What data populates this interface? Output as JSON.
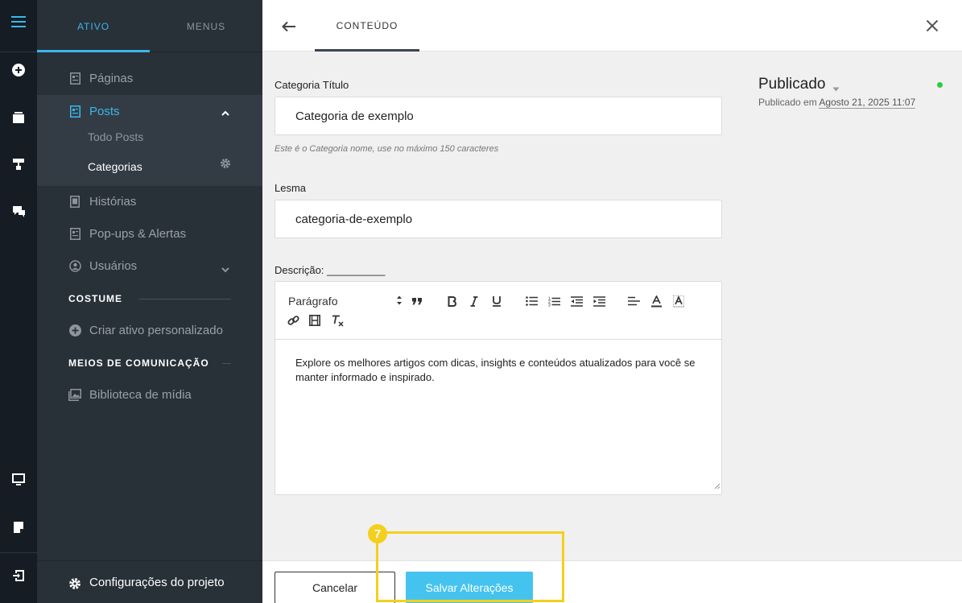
{
  "sidebar": {
    "tabs": [
      "ATIVO",
      "MENUS"
    ],
    "items": {
      "paginas": "Páginas",
      "posts": "Posts",
      "todo_posts": "Todo Posts",
      "categorias": "Categorias",
      "historias": "Histórias",
      "popups": "Pop-ups & Alertas",
      "usuarios": "Usuários"
    },
    "section_costume": "COSTUME",
    "criar_ativo": "Criar ativo personalizado",
    "section_meios": "MEIOS DE COMUNICAÇÃO",
    "biblioteca": "Biblioteca de mídia",
    "footer": "Configurações do projeto"
  },
  "header": {
    "tab": "CONTEÚDO"
  },
  "form": {
    "title_label": "Categoria Título",
    "title_value": "Categoria de exemplo",
    "title_hint": "Este é o Categoria nome, use no máximo 150 caracteres",
    "slug_label": "Lesma",
    "slug_value": "categoria-de-exemplo",
    "desc_label": "Descrição: __________",
    "paragraph_select": "Parágrafo",
    "desc_body": "Explore os melhores artigos com dicas, insights e conteúdos atualizados para você se manter informado e inspirado."
  },
  "status": {
    "label": "Publicado",
    "published_prefix": "Publicado em",
    "published_date": "Agosto 21, 2025 11:07",
    "dot_color": "#2ecc40"
  },
  "actions": {
    "cancel": "Cancelar",
    "save": "Salvar Alterações"
  },
  "annotation": {
    "step": "7",
    "color": "#f5cf1e"
  },
  "colors": {
    "accent": "#3bb7ea",
    "save_button": "#45c3ef",
    "rail_bg": "#151c24",
    "sidebar_bg": "#283038"
  }
}
